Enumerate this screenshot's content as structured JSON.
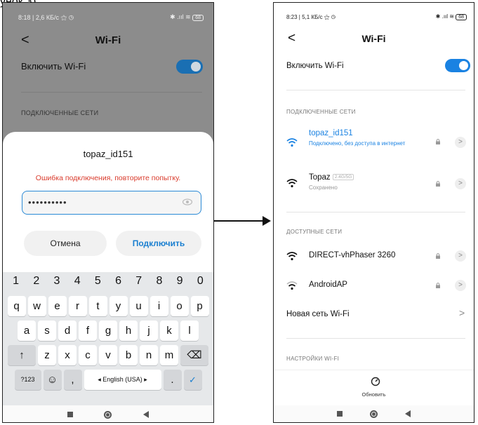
{
  "caption": "унок 3),",
  "left_phone": {
    "status": {
      "left": "8:18 | 2,6 КБ/с ⚝ ◷",
      "right": "✱ .ııl ≋",
      "battery": "68"
    },
    "header": {
      "back": "<",
      "title": "Wi-Fi"
    },
    "wifi_toggle": {
      "label": "Включить Wi-Fi",
      "on": true
    },
    "connected_section": "ПОДКЛЮЧЕННЫЕ СЕТИ",
    "dialog": {
      "title": "topaz_id151",
      "error": "Ошибка подключения, повторите попытку.",
      "password_value": "••••••••••",
      "cancel": "Отмена",
      "connect": "Подключить"
    },
    "keyboard": {
      "numbers": [
        "1",
        "2",
        "3",
        "4",
        "5",
        "6",
        "7",
        "8",
        "9",
        "0"
      ],
      "row1": [
        "q",
        "w",
        "e",
        "r",
        "t",
        "y",
        "u",
        "i",
        "o",
        "p"
      ],
      "row2": [
        "a",
        "s",
        "d",
        "f",
        "g",
        "h",
        "j",
        "k",
        "l"
      ],
      "row3": [
        "z",
        "x",
        "c",
        "v",
        "b",
        "n",
        "m"
      ],
      "shift": "↑",
      "backspace": "⌫",
      "symbols": "?123",
      "emoji": "☺",
      "comma": ",",
      "space": "◂ English (USA) ▸",
      "period": ".",
      "enter": "✓"
    }
  },
  "right_phone": {
    "status": {
      "left": "8:23 | 5,1 КБ/с ⚝ ◷",
      "right": "✱ .ııl ≋",
      "battery": "68"
    },
    "header": {
      "back": "<",
      "title": "Wi-Fi"
    },
    "wifi_toggle": {
      "label": "Включить Wi-Fi",
      "on": true
    },
    "connected_section": "ПОДКЛЮЧЕННЫЕ СЕТИ",
    "connected": [
      {
        "name": "topaz_id151",
        "status": "Подключено, без доступа в интернет",
        "active": true
      },
      {
        "name": "Topaz",
        "badge": "2.4G/5G",
        "status": "Сохранено",
        "active": false
      }
    ],
    "available_section": "ДОСТУПНЫЕ СЕТИ",
    "available": [
      {
        "name": "DIRECT-vhPhaser 3260"
      },
      {
        "name": "AndroidAP"
      }
    ],
    "new_network": "Новая сеть Wi-Fi",
    "settings_section": "НАСТРОЙКИ WI-FI",
    "refresh": "Обновить"
  }
}
